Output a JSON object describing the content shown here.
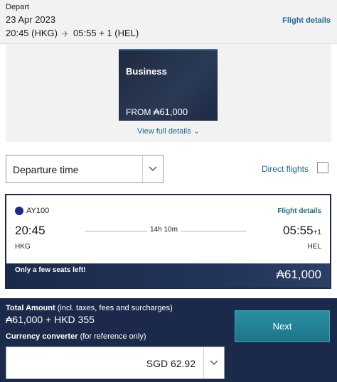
{
  "header": {
    "label": "Depart",
    "date": "23 Apr 2023",
    "departure": "20:45 (HKG)",
    "arrival": "05:55 + 1 (HEL)",
    "flight_details_link": "Flight details"
  },
  "fare_card": {
    "cabin": "Business",
    "from_label": "FROM",
    "price": "₳61,000",
    "view_full_details": "View full details"
  },
  "filters": {
    "sort_label": "Departure time",
    "direct_flights_label": "Direct flights",
    "direct_flights_checked": false
  },
  "flight": {
    "number": "AY100",
    "details_link": "Flight details",
    "dep_time": "20:45",
    "dep_code": "HKG",
    "duration": "14h 10m",
    "arr_time": "05:55",
    "arr_day_offset": "+1",
    "arr_code": "HEL",
    "seats_notice": "Only a few seats left!",
    "price": "₳61,000"
  },
  "footer": {
    "total_label": "Total Amount",
    "total_note": "(incl. taxes, fees and surcharges)",
    "total_value": "₳61,000 + HKD 355",
    "currency_label": "Currency converter",
    "currency_note": "(for reference only)",
    "currency_value": "SGD 62.92",
    "next_label": "Next"
  },
  "colors": {
    "navy": "#1b2a4a",
    "teal_link": "#1e6b8a",
    "next_button": "#2a8fa3"
  },
  "icons": [
    "plane-icon",
    "chevron-down-icon",
    "airline-logo-icon"
  ]
}
